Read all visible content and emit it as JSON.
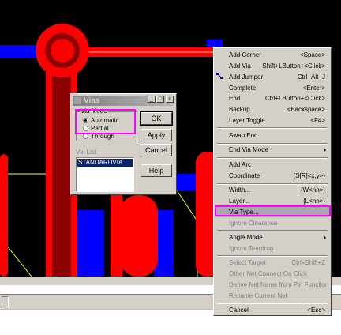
{
  "dialog": {
    "title": "Vias",
    "title_buttons": [
      "_",
      "□",
      "×"
    ],
    "via_mode_label": "Via Mode",
    "modes": [
      {
        "label": "Automatic",
        "selected": true
      },
      {
        "label": "Partial",
        "selected": false
      },
      {
        "label": "Through",
        "selected": false
      }
    ],
    "via_list_label": "Via List",
    "via_list_items": [
      "STANDARDVIA"
    ],
    "buttons": {
      "ok": "OK",
      "apply": "Apply",
      "cancel": "Cancel",
      "help": "Help"
    }
  },
  "menu": {
    "items": [
      {
        "label": "Add Corner",
        "shortcut": "<Space>",
        "enabled": true
      },
      {
        "label": "Add Via",
        "shortcut": "Shift+LButton+<Click>",
        "enabled": true
      },
      {
        "label": "Add Jumper",
        "shortcut": "Ctrl+Alt+J",
        "enabled": true
      },
      {
        "label": "Complete",
        "shortcut": "<Enter>",
        "enabled": true
      },
      {
        "label": "End",
        "shortcut": "Ctrl+LButton+<Click>",
        "enabled": true
      },
      {
        "label": "Backup",
        "shortcut": "<Backspace>",
        "enabled": true
      },
      {
        "label": "Layer Toggle",
        "shortcut": "<F4>",
        "enabled": true
      },
      {
        "label": "Swap End",
        "shortcut": "",
        "enabled": true
      },
      {
        "label": "End Via Mode",
        "shortcut": "",
        "enabled": true,
        "submenu": true
      },
      {
        "label": "Add Arc",
        "shortcut": "",
        "enabled": true
      },
      {
        "label": "Coordinate",
        "shortcut": "{S[R]<x,y>}",
        "enabled": true
      },
      {
        "label": "Width...",
        "shortcut": "{W<nn>}",
        "enabled": true
      },
      {
        "label": "Layer...",
        "shortcut": "{L<nn>}",
        "enabled": true
      },
      {
        "label": "Via Type...",
        "shortcut": "",
        "enabled": true,
        "highlighted": true
      },
      {
        "label": "Ignore Clearance",
        "shortcut": "",
        "enabled": false
      },
      {
        "label": "Angle Mode",
        "shortcut": "",
        "enabled": true,
        "submenu": true
      },
      {
        "label": "Ignore Teardrop",
        "shortcut": "",
        "enabled": false
      },
      {
        "label": "Select Target",
        "shortcut": "Ctrl+Shift+Z",
        "enabled": false
      },
      {
        "label": "Other Net Connect On Click",
        "shortcut": "",
        "enabled": false
      },
      {
        "label": "Derive Net Name from Pin Function",
        "shortcut": "",
        "enabled": false
      },
      {
        "label": "Rename Current Net",
        "shortcut": "",
        "enabled": false
      },
      {
        "label": "Cancel",
        "shortcut": "<Esc>",
        "enabled": true
      }
    ]
  },
  "colors": {
    "canvas_bg": "#000000",
    "top_copper": "#ff0000",
    "bottom_copper": "#0000ff",
    "highlight": "#ff00ff",
    "outline": "#ffff00"
  },
  "icons": [
    "add-jumper-icon",
    "restore-icon",
    "minimize-icon",
    "close-icon",
    "submenu-arrow-icon"
  ]
}
